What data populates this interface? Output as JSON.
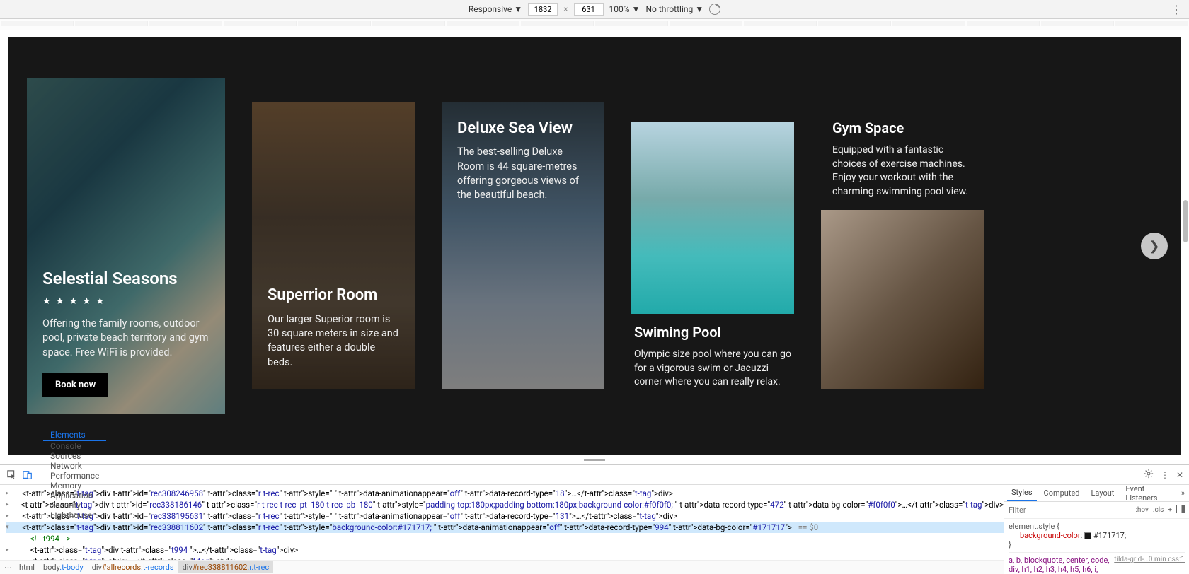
{
  "deviceBar": {
    "mode": "Responsive",
    "width": "1832",
    "height": "631",
    "zoom": "100%",
    "throttle": "No throttling"
  },
  "cards": [
    {
      "title": "Selestial Seasons",
      "stars": "★ ★ ★ ★ ★",
      "desc": "Offering the family rooms, outdoor pool, private beach territory and gym space. Free WiFi is provided.",
      "cta": "Book now"
    },
    {
      "title": "Superrior Room",
      "desc": "Our larger Superior room is 30 square meters in size and features either a double beds."
    },
    {
      "title": "Deluxe Sea View",
      "desc": "The best-selling Deluxe Room is 44 square-metres offering gorgeous views of the beautiful beach."
    },
    {
      "title": "Swiming Pool",
      "desc": "Olympic size pool where you can go for a vigorous swim or Jacuzzi corner where you can really relax."
    },
    {
      "title": "Gym Space",
      "desc": "Equipped with a fantastic choices of exercise machines. Enjoy your workout with the charming swimming pool view."
    }
  ],
  "devtoolsTabs": [
    "Elements",
    "Console",
    "Sources",
    "Network",
    "Performance",
    "Memory",
    "Application",
    "Security",
    "Lighthouse"
  ],
  "activeTab": "Elements",
  "domLines": [
    {
      "indent": 2,
      "tw": "▸",
      "html": "<div id=\"rec308246958\" class=\"r t-rec\" style=\" \" data-animationappear=\"off\" data-record-type=\"18\">…</div>"
    },
    {
      "indent": 2,
      "tw": "▸",
      "html": "<div id=\"rec338186146\" class=\"r t-rec t-rec_pt_180 t-rec_pb_180\" style=\"padding-top:180px;padding-bottom:180px;background-color:#f0f0f0; \" data-record-type=\"472\" data-bg-color=\"#f0f0f0\">…</div>"
    },
    {
      "indent": 2,
      "tw": "▸",
      "html": "<div id=\"rec338195631\" class=\"r t-rec\" style=\" \" data-animationappear=\"off\" data-record-type=\"131\">…</div>"
    },
    {
      "indent": 2,
      "tw": "▾",
      "sel": true,
      "html": "<div id=\"rec338811602\" class=\"r t-rec\" style=\"background-color:#171717; \" data-animationappear=\"off\" data-record-type=\"994\" data-bg-color=\"#171717\">",
      "eq0": " == $0"
    },
    {
      "indent": 4,
      "cmt": "<!-- t994 -->"
    },
    {
      "indent": 4,
      "tw": "▸",
      "html": "<div class=\"t994 \">…</div>"
    },
    {
      "indent": 4,
      "raw": "<style>…</style>"
    }
  ],
  "breadcrumbs": [
    {
      "label": "html"
    },
    {
      "label": "body.t-body"
    },
    {
      "label": "div#allrecords.t-records"
    },
    {
      "label": "div#rec338811602.r.t-rec",
      "active": true
    }
  ],
  "stylesTabs": [
    "Styles",
    "Computed",
    "Layout",
    "Event Listeners"
  ],
  "filterPlaceholder": "Filter",
  "filterBtns": [
    ":hov",
    ".cls",
    "+"
  ],
  "styleRule": {
    "selector": "element.style {",
    "propName": "background-color",
    "propVal": "#171717;"
  },
  "inheritRule": "a, b, blockquote, center, code, div, h1, h2, h3, h4, h5, h6, i,",
  "inheritLink": "tilda-grid-…0.min.css:1"
}
